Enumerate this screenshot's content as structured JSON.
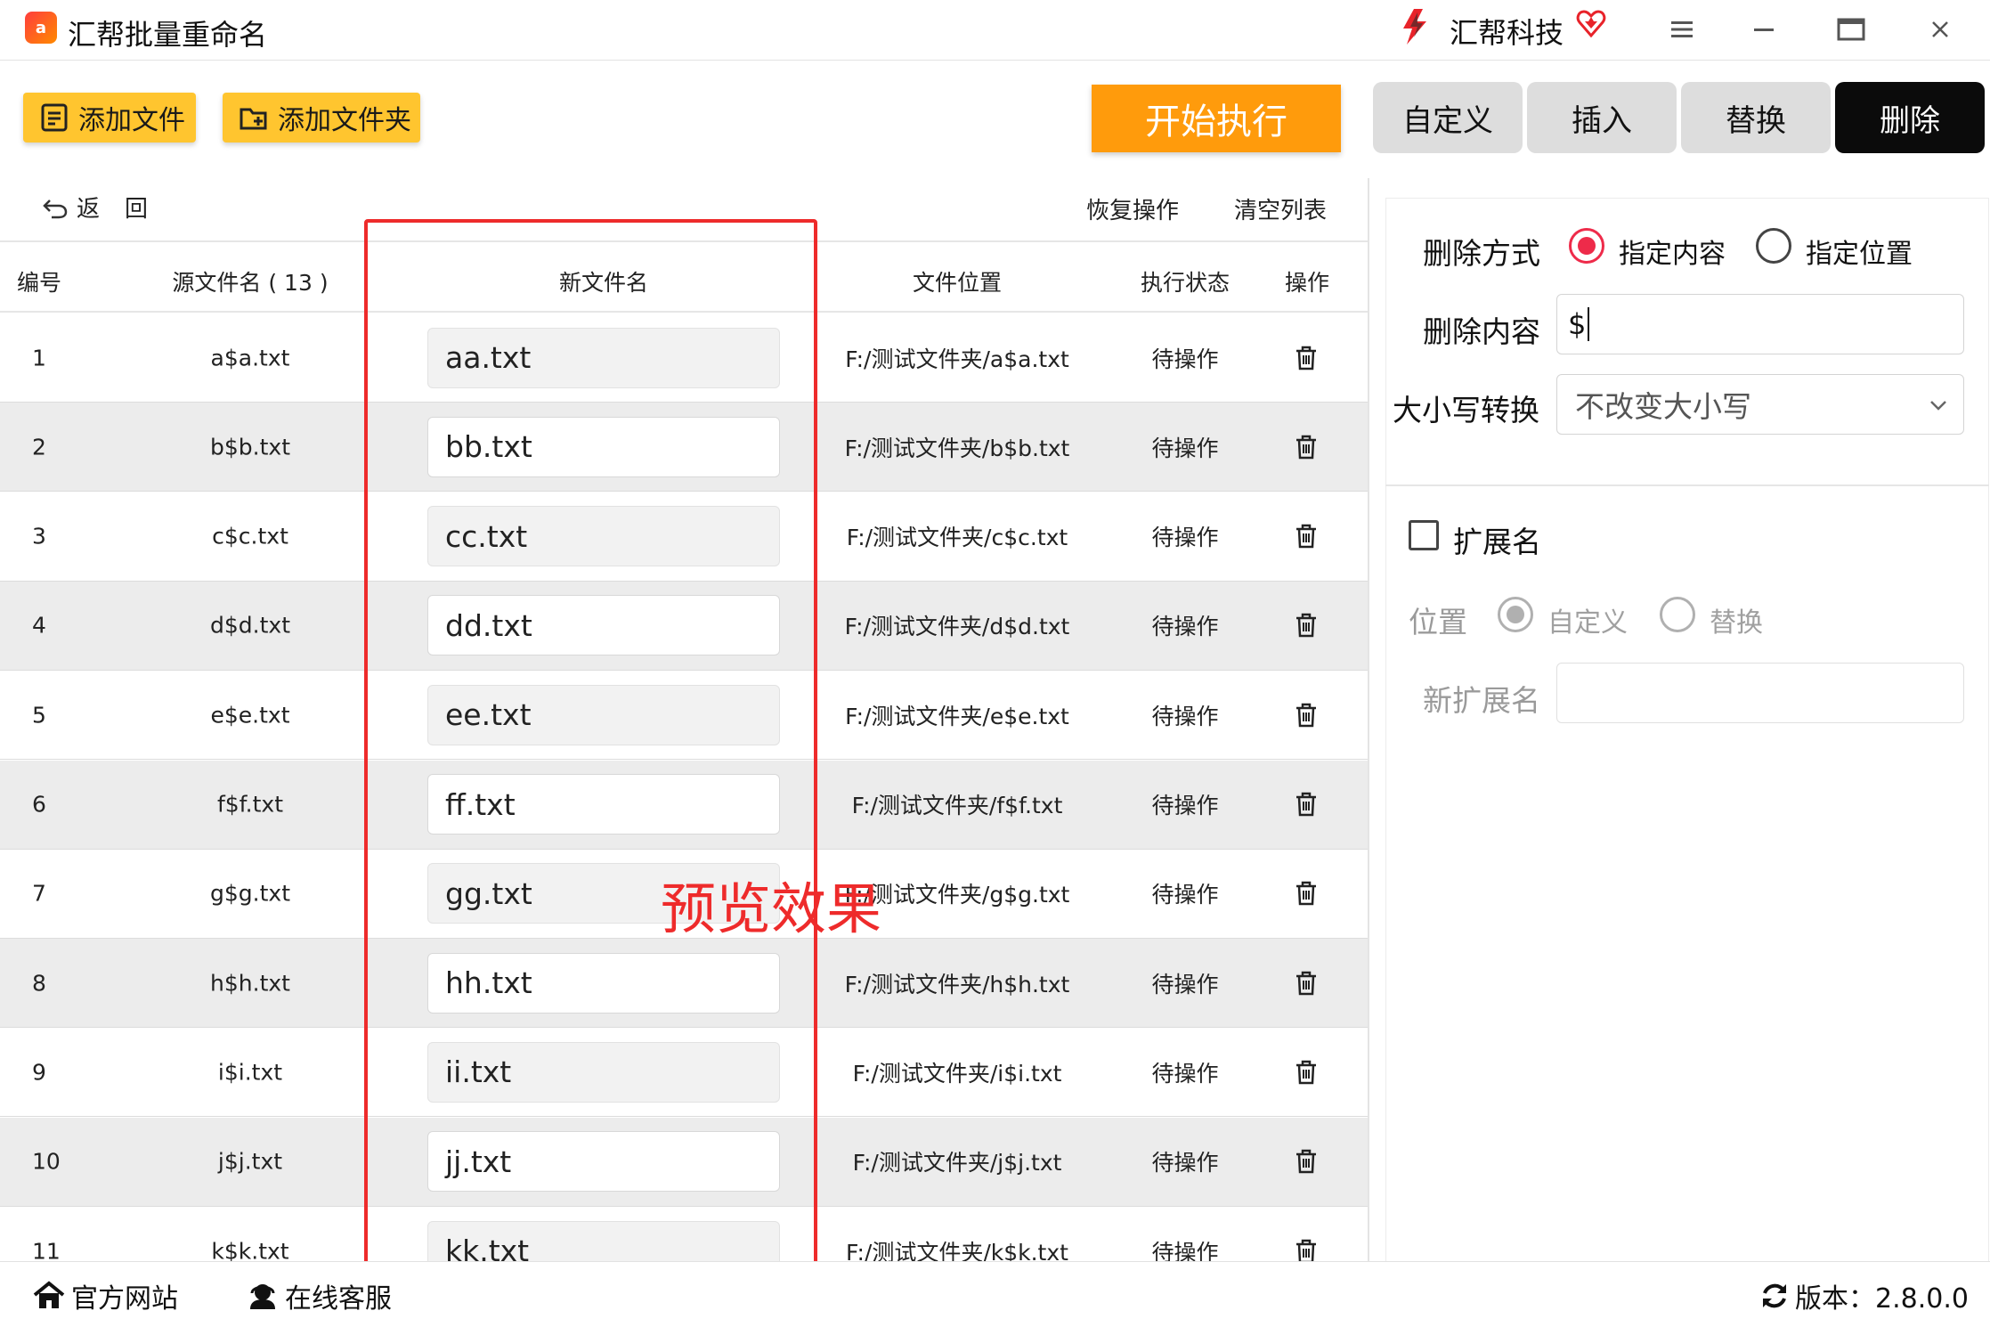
{
  "titlebar": {
    "app_icon_text": "a",
    "app_title": "汇帮批量重命名",
    "brand_name": "汇帮科技"
  },
  "toolbar": {
    "add_file": "添加文件",
    "add_folder": "添加文件夹",
    "start": "开始执行"
  },
  "tabs": [
    {
      "label": "自定义",
      "active": false
    },
    {
      "label": "插入",
      "active": false
    },
    {
      "label": "替换",
      "active": false
    },
    {
      "label": "删除",
      "active": true
    }
  ],
  "subbar": {
    "back": "返回",
    "restore": "恢复操作",
    "clear": "清空列表"
  },
  "table": {
    "headers": {
      "num": "编号",
      "source": "源文件名 ( 13 )",
      "newname": "新文件名",
      "location": "文件位置",
      "status": "执行状态",
      "action": "操作"
    },
    "rows": [
      {
        "num": "1",
        "source": "a$a.txt",
        "newname": "aa.txt",
        "location": "F:/测试文件夹/a$a.txt",
        "status": "待操作"
      },
      {
        "num": "2",
        "source": "b$b.txt",
        "newname": "bb.txt",
        "location": "F:/测试文件夹/b$b.txt",
        "status": "待操作"
      },
      {
        "num": "3",
        "source": "c$c.txt",
        "newname": "cc.txt",
        "location": "F:/测试文件夹/c$c.txt",
        "status": "待操作"
      },
      {
        "num": "4",
        "source": "d$d.txt",
        "newname": "dd.txt",
        "location": "F:/测试文件夹/d$d.txt",
        "status": "待操作"
      },
      {
        "num": "5",
        "source": "e$e.txt",
        "newname": "ee.txt",
        "location": "F:/测试文件夹/e$e.txt",
        "status": "待操作"
      },
      {
        "num": "6",
        "source": "f$f.txt",
        "newname": "ff.txt",
        "location": "F:/测试文件夹/f$f.txt",
        "status": "待操作"
      },
      {
        "num": "7",
        "source": "g$g.txt",
        "newname": "gg.txt",
        "location": "F:/测试文件夹/g$g.txt",
        "status": "待操作"
      },
      {
        "num": "8",
        "source": "h$h.txt",
        "newname": "hh.txt",
        "location": "F:/测试文件夹/h$h.txt",
        "status": "待操作"
      },
      {
        "num": "9",
        "source": "i$i.txt",
        "newname": "ii.txt",
        "location": "F:/测试文件夹/i$i.txt",
        "status": "待操作"
      },
      {
        "num": "10",
        "source": "j$j.txt",
        "newname": "jj.txt",
        "location": "F:/测试文件夹/j$j.txt",
        "status": "待操作"
      },
      {
        "num": "11",
        "source": "k$k.txt",
        "newname": "kk.txt",
        "location": "F:/测试文件夹/k$k.txt",
        "status": "待操作"
      }
    ]
  },
  "annotation": {
    "preview_label": "预览效果",
    "color": "#ee2b2b"
  },
  "panel": {
    "delete_mode_label": "删除方式",
    "mode_options": [
      "指定内容",
      "指定位置"
    ],
    "mode_selected": "指定内容",
    "delete_content_label": "删除内容",
    "delete_content_value": "$",
    "case_label": "大小写转换",
    "case_value": "不改变大小写",
    "extension_label": "扩展名",
    "extension_checked": false,
    "position_label": "位置",
    "position_options": [
      "自定义",
      "替换"
    ],
    "position_selected": "自定义",
    "new_ext_label": "新扩展名",
    "new_ext_value": ""
  },
  "statusbar": {
    "website": "官方网站",
    "support": "在线客服",
    "version": "版本：2.8.0.0"
  },
  "colors": {
    "toolbar_yellow": "#ffc52f",
    "start_orange": "#ff9b0c",
    "active_tab": "#0b0b0b",
    "radio_accent": "#ee2b4a"
  }
}
